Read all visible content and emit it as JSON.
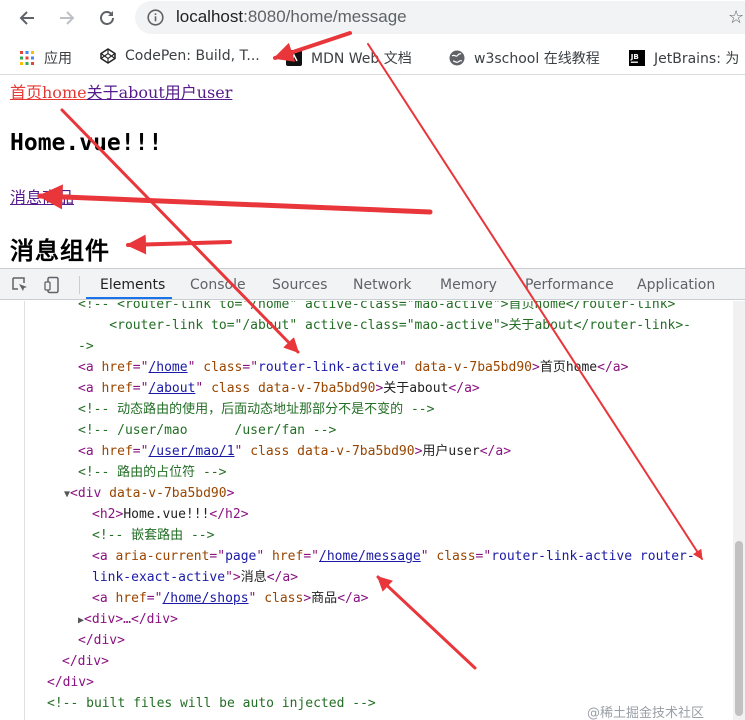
{
  "browser": {
    "url_host": "localhost",
    "url_rest": ":8080/home/message",
    "star": "☆",
    "bookmarks": [
      {
        "label": "应用",
        "icon": "apps-grid-icon"
      },
      {
        "label": "CodePen: Build, T...",
        "icon": "codepen-icon"
      },
      {
        "label": "MDN Web 文档",
        "icon": "mdn-icon"
      },
      {
        "label": "w3school 在线教程",
        "icon": "globe-icon"
      },
      {
        "label": "JetBrains: 为",
        "icon": "jetbrains-icon"
      }
    ]
  },
  "page": {
    "nav": {
      "home": "首页home",
      "about": "关于about",
      "user": "用户user"
    },
    "heading": "Home.vue!!!",
    "sub_nav": {
      "message": "消息",
      "shops": "商品"
    },
    "component_title": "消息组件"
  },
  "devtools": {
    "tabs": [
      "Elements",
      "Console",
      "Sources",
      "Network",
      "Memory",
      "Performance",
      "Application"
    ],
    "active_tab": "Elements",
    "code": {
      "l0_a": "<!-- <router-link to=\"/home\" active-class=\"mao-active\">首页home</router-link>",
      "l1_a": "    <router-link to=\"/about\" active-class=\"mao-active\">关于about</router-link>-",
      "l2_a": "->",
      "l3_open": "<a ",
      "l3_href_attr": "href",
      "l3_href": "/home",
      "l3_class_attr": "class",
      "l3_class": "router-link-active",
      "l3_data": "data-v-7ba5bd90",
      "l3_text": "首页home",
      "l3_close": "</a>",
      "l4_href": "/about",
      "l4_class_attr": "class",
      "l4_data": "data-v-7ba5bd90",
      "l4_text": "关于about",
      "l5_comment": "<!-- 动态路由的使用，后面动态地址那部分不是不变的 -->",
      "l6_comment": "<!-- /user/mao      /user/fan -->",
      "l7_href": "/user/mao/1",
      "l7_data": "data-v-7ba5bd90",
      "l7_text": "用户user",
      "l8_comment": "<!-- 路由的占位符 -->",
      "l9_div": "<div ",
      "l9_data": "data-v-7ba5bd90",
      "l10_h2_open": "<h2>",
      "l10_text": "Home.vue!!!",
      "l10_h2_close": "</h2>",
      "l11_comment": "<!-- 嵌套路由 -->",
      "l12_aria_attr": "aria-current",
      "l12_aria": "page",
      "l12_href": "/home/message",
      "l12_class_attr": "class",
      "l12_class_a": "router-link-active router-",
      "l13_class_b": "link-exact-active",
      "l13_text": "消息",
      "l14_href": "/home/shops",
      "l14_text": "商品",
      "l15_div": "<div>…</div>",
      "l16": "</div>",
      "l17": "</div>",
      "l18": "</div>",
      "l19_comment": "<!-- built files will be auto injected -->"
    },
    "watermark": "@稀土掘金技术社区"
  },
  "colors": {
    "annotation_arrow": "#e8363b",
    "active_link": "#e53935",
    "visited_link": "#551a8b",
    "devtools_tab_underline": "#1a73e8"
  }
}
